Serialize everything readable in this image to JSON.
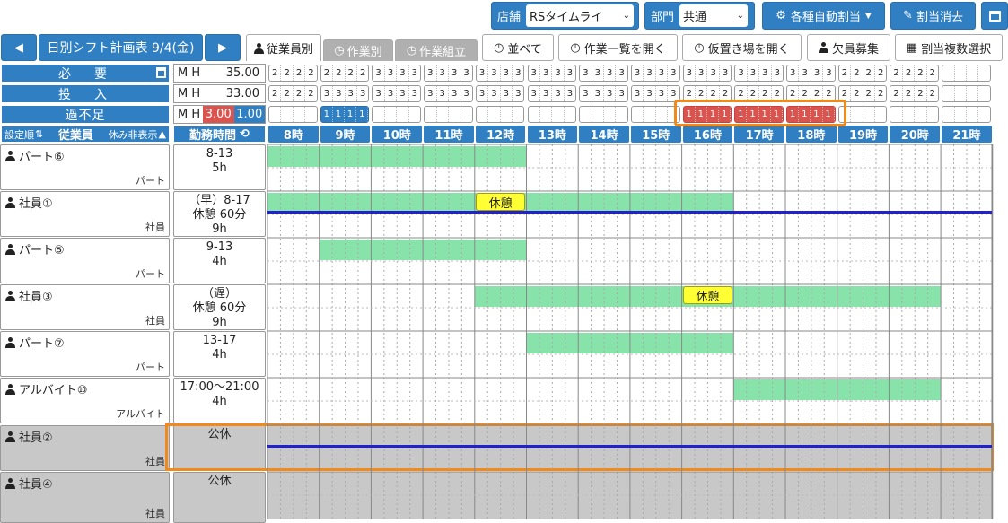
{
  "toolbar": {
    "store_label": "店舗",
    "store_value": "RSタイムライ",
    "dept_label": "部門",
    "dept_value": "共通",
    "auto_assign": "各種自動割当",
    "clear_assign": "割当消去"
  },
  "nav": {
    "title": "日別シフト計画表 9/4(金)",
    "tabs": [
      "従業員別",
      "作業別",
      "作業組立"
    ],
    "buttons": [
      "並べて",
      "作業一覧を開く",
      "仮置き場を開く",
      "欠員募集",
      "割当複数選択"
    ]
  },
  "summary": {
    "required_label": "必　要",
    "input_label": "投　入",
    "diff_label": "過不足",
    "mh": "M H",
    "required_value": "35.00",
    "input_value": "33.00",
    "diff_neg": "3.00",
    "diff_pos": "1.00",
    "required_cells": [
      [
        2,
        2,
        2,
        2
      ],
      [
        2,
        2,
        2,
        2
      ],
      [
        3,
        3,
        3,
        3
      ],
      [
        3,
        3,
        3,
        3
      ],
      [
        3,
        3,
        3,
        3
      ],
      [
        3,
        3,
        3,
        3
      ],
      [
        3,
        3,
        3,
        3
      ],
      [
        3,
        3,
        3,
        3
      ],
      [
        3,
        3,
        3,
        3
      ],
      [
        3,
        3,
        3,
        3
      ],
      [
        3,
        3,
        3,
        3
      ],
      [
        2,
        2,
        2,
        2
      ],
      [
        2,
        2,
        2,
        2
      ],
      []
    ],
    "input_cells": [
      [
        2,
        2,
        2,
        2
      ],
      [
        3,
        3,
        3,
        3
      ],
      [
        3,
        3,
        3,
        3
      ],
      [
        3,
        3,
        3,
        3
      ],
      [
        3,
        3,
        3,
        3
      ],
      [
        3,
        3,
        3,
        3
      ],
      [
        3,
        3,
        3,
        3
      ],
      [
        3,
        3,
        3,
        3
      ],
      [
        2,
        2,
        2,
        2
      ],
      [
        2,
        2,
        2,
        2
      ],
      [
        2,
        2,
        2,
        2
      ],
      [
        2,
        2,
        2,
        2
      ],
      [
        2,
        2,
        2,
        2
      ],
      []
    ],
    "diff_cells": [
      [],
      [
        1,
        1,
        1,
        1
      ],
      [],
      [],
      [],
      [],
      [],
      [],
      [
        1,
        1,
        1,
        1
      ],
      [
        1,
        1,
        1,
        1
      ],
      [
        1,
        1,
        1,
        1
      ],
      [],
      [],
      []
    ],
    "diff_types": [
      "",
      "blue",
      "",
      "",
      "",
      "",
      "",
      "",
      "red",
      "red",
      "red",
      "",
      "",
      ""
    ]
  },
  "header": {
    "sort_label": "設定順",
    "employee_label": "従業員",
    "hide_label": "休み非表示",
    "hours_label": "勤務時間",
    "hours": [
      "8時",
      "9時",
      "10時",
      "11時",
      "12時",
      "13時",
      "14時",
      "15時",
      "16時",
      "17時",
      "18時",
      "19時",
      "20時",
      "21時"
    ]
  },
  "employees": [
    {
      "name": "パート⑥",
      "type": "パート",
      "hours_line1": "8-13",
      "hours_line2": "5h",
      "hours_line3": "",
      "off": false,
      "start": 8,
      "end": 13,
      "break_at": null,
      "line": false
    },
    {
      "name": "社員①",
      "type": "社員",
      "hours_line1": "（早）8-17",
      "hours_line2": "休憩 60分",
      "hours_line3": "9h",
      "off": false,
      "start": 8,
      "end": 17,
      "break_at": 12,
      "line": true
    },
    {
      "name": "パート⑤",
      "type": "パート",
      "hours_line1": "9-13",
      "hours_line2": "4h",
      "hours_line3": "",
      "off": false,
      "start": 9,
      "end": 13,
      "break_at": null,
      "line": false
    },
    {
      "name": "社員③",
      "type": "社員",
      "hours_line1": "（遅）",
      "hours_line2": "休憩 60分",
      "hours_line3": "9h",
      "off": false,
      "start": 12,
      "end": 21,
      "break_at": 16,
      "line": false
    },
    {
      "name": "パート⑦",
      "type": "パート",
      "hours_line1": "13-17",
      "hours_line2": "4h",
      "hours_line3": "",
      "off": false,
      "start": 13,
      "end": 17,
      "break_at": null,
      "line": false
    },
    {
      "name": "アルバイト⑩",
      "type": "アルバイト",
      "hours_line1": "17:00～21:00",
      "hours_line2": "4h",
      "hours_line3": "",
      "off": false,
      "start": 17,
      "end": 21,
      "break_at": null,
      "line": false
    },
    {
      "name": "社員②",
      "type": "社員",
      "hours_line1": "公休",
      "hours_line2": "",
      "hours_line3": "",
      "off": true,
      "start": null,
      "end": null,
      "break_at": null,
      "line": true
    },
    {
      "name": "社員④",
      "type": "社員",
      "hours_line1": "公休",
      "hours_line2": "",
      "hours_line3": "",
      "off": true,
      "start": null,
      "end": null,
      "break_at": null,
      "line": false
    }
  ],
  "break_label": "休憩",
  "colors": {
    "accent": "#2f7fc2",
    "work": "#88e3aa",
    "break": "#ffff33",
    "shortage": "#d9534f",
    "highlight": "#f08a1c",
    "line": "#2222cc"
  }
}
